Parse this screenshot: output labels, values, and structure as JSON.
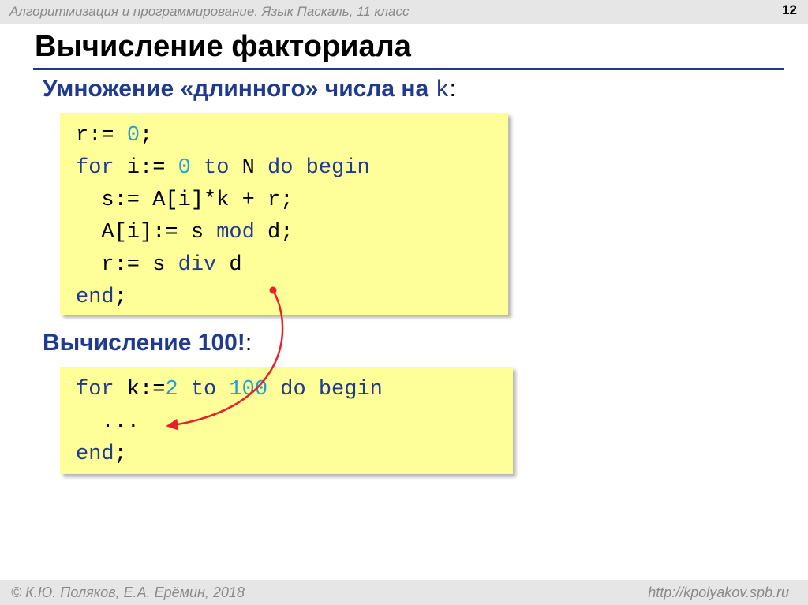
{
  "header": {
    "course": "Алгоритмизация и программирование. Язык Паскаль, 11 класс",
    "slide_number": "12"
  },
  "title": "Вычисление факториала",
  "section1": {
    "heading": "Умножение «длинного» числа на ",
    "var": "k",
    "colon": ":"
  },
  "code1": {
    "l1": {
      "a": "r:= ",
      "b": "0",
      "c": ";"
    },
    "l2": {
      "a": "for",
      "b": " i:= ",
      "c": "0",
      "d": " to",
      "e": " N ",
      "f": "do begin"
    },
    "l3": {
      "a": "  s:= A[i]*k + r;"
    },
    "l4": {
      "a": "  A[i]:= s ",
      "b": "mod",
      "c": " d;"
    },
    "l5": {
      "a": "  r:= s ",
      "b": "div",
      "c": " d"
    },
    "l6": {
      "a": "end",
      "b": ";"
    }
  },
  "section2": {
    "heading": "Вычисление 100!",
    "colon": ":"
  },
  "code2": {
    "l1": {
      "a": "for",
      "b": " k:=",
      "c": "2",
      "d": " to ",
      "e": "100",
      "f": " do begin"
    },
    "l2": {
      "a": "  ..."
    },
    "l3": {
      "a": "end",
      "b": ";"
    }
  },
  "footer": {
    "authors": "© К.Ю. Поляков, Е.А. Ерёмин, 2018",
    "url": "http://kpolyakov.spb.ru"
  },
  "colors": {
    "keyword": "#1f3a8f",
    "number": "#1ea0d8",
    "code_bg": "#ffff99",
    "arrow": "#e8202a"
  }
}
